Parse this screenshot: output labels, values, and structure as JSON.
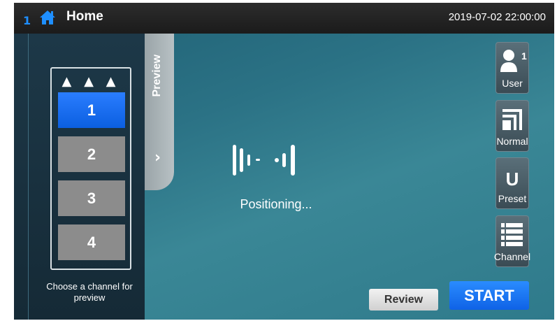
{
  "topbar": {
    "channel_indicator": "1",
    "title": "Home",
    "datetime": "2019-07-02 22:00:00"
  },
  "channel_panel": {
    "scroll_up": "▲ ▲ ▲",
    "channels": [
      "1",
      "2",
      "3",
      "4"
    ],
    "selected": "1",
    "hint": "Choose a channel for preview"
  },
  "preview": {
    "label": "Preview",
    "chevron": "›"
  },
  "status": {
    "text": "Positioning..."
  },
  "side_buttons": {
    "user": {
      "label": "User",
      "badge": "1",
      "icon": "user-icon"
    },
    "mode": {
      "label": "Normal",
      "icon": "normal-mode-icon"
    },
    "preset": {
      "label": "Preset",
      "glyph": "U",
      "icon": "preset-icon"
    },
    "channel": {
      "label": "Channel",
      "icon": "list-icon"
    }
  },
  "actions": {
    "review": "Review",
    "start": "START"
  },
  "colors": {
    "accent_blue": "#1e8fff",
    "start_blue": "#0f62e6",
    "channel_gray": "#8c8c8c"
  }
}
